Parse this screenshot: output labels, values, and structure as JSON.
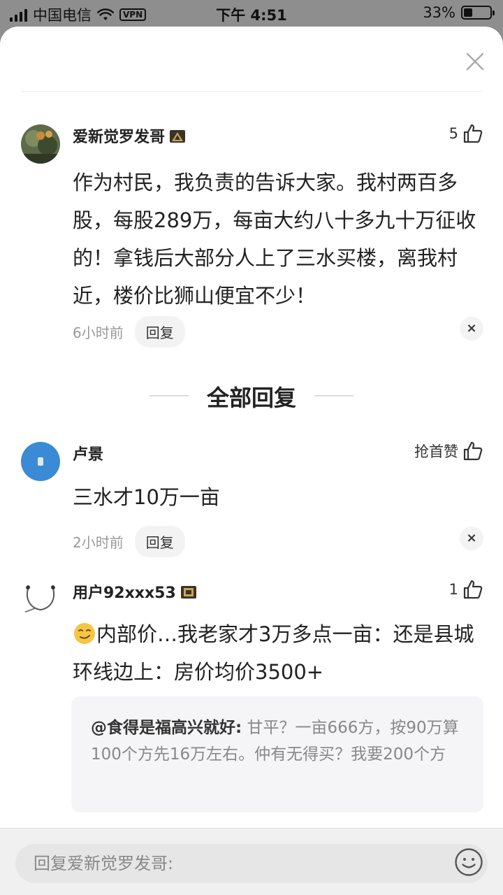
{
  "status_bar": {
    "carrier": "中国电信",
    "vpn": "VPN",
    "time": "下午 4:51",
    "battery": "33%",
    "battery_level": 0.33
  },
  "main_comment": {
    "username": "爱新觉罗发哥",
    "likes": "5",
    "text": "作为村民，我负责的告诉大家。我村两百多股，每股289万，每亩大约八十多九十万征收的！拿钱后大部分人上了三水买楼，离我村近，楼价比狮山便宜不少！",
    "time": "6小时前",
    "reply_label": "回复",
    "dismiss": "×"
  },
  "section": {
    "title": "全部回复"
  },
  "replies": [
    {
      "username": "卢景",
      "likes": "抢首赞",
      "text": "三水才10万一亩",
      "time": "2小时前",
      "reply_label": "回复",
      "dismiss": "×"
    },
    {
      "username": "用户92xxx53",
      "likes": "1",
      "text": "内部价…我老家才3万多点一亩：还是县城环线边上：房价均价3500+",
      "quote_name": "@食得是福高兴就好:",
      "quote_text": " 甘平？一亩666方，按90万算100个方先16万左右。仲有无得买？我要200个方"
    }
  ],
  "input": {
    "placeholder": "回复爱新觉罗发哥:"
  }
}
